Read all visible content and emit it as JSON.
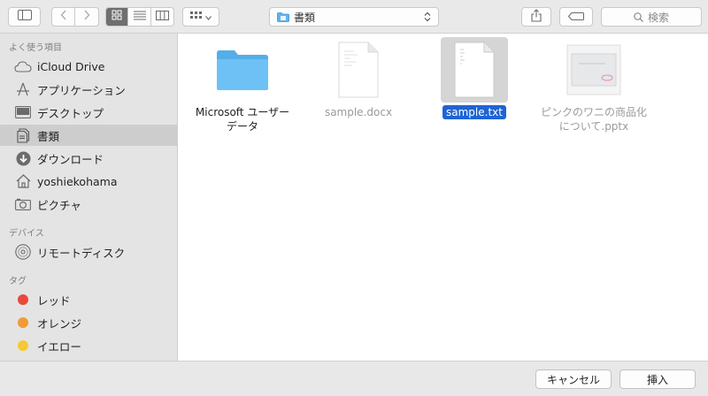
{
  "toolbar": {
    "path_popup_label": "書類",
    "search_placeholder": "検索"
  },
  "sidebar": {
    "favorites_header": "よく使う項目",
    "favorites": [
      {
        "label": "iCloud Drive",
        "icon": "cloud-icon"
      },
      {
        "label": "アプリケーション",
        "icon": "applications-icon"
      },
      {
        "label": "デスクトップ",
        "icon": "desktop-icon"
      },
      {
        "label": "書類",
        "icon": "documents-icon",
        "selected": true
      },
      {
        "label": "ダウンロード",
        "icon": "download-icon"
      },
      {
        "label": "yoshiekohama",
        "icon": "home-icon"
      },
      {
        "label": "ピクチャ",
        "icon": "camera-icon"
      }
    ],
    "devices_header": "デバイス",
    "devices": [
      {
        "label": "リモートディスク",
        "icon": "disc-icon"
      }
    ],
    "tags_header": "タグ",
    "tags": [
      {
        "label": "レッド",
        "color": "#e9493d"
      },
      {
        "label": "オレンジ",
        "color": "#f19a38"
      },
      {
        "label": "イエロー",
        "color": "#f6c834"
      }
    ]
  },
  "files": [
    {
      "name_line1": "Microsoft ユーザー",
      "name_line2": "データ",
      "kind": "folder",
      "dimmed": false
    },
    {
      "name_line1": "sample.docx",
      "name_line2": "",
      "kind": "document",
      "badge": "DOCX",
      "dimmed": true
    },
    {
      "name_line1": "sample.txt",
      "name_line2": "",
      "kind": "document",
      "badge": "TXT",
      "selected": true
    },
    {
      "name_line1": "ピンクのワニの商品化",
      "name_line2": "について.pptx",
      "kind": "presentation",
      "dimmed": true
    }
  ],
  "buttons": {
    "cancel": "キャンセル",
    "insert": "挿入"
  }
}
